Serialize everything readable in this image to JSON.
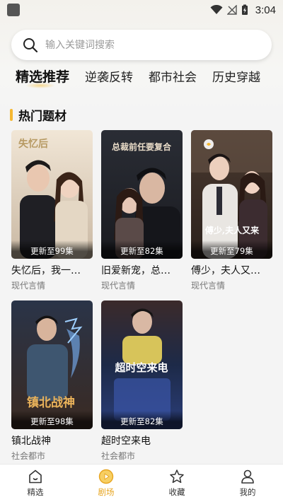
{
  "status_bar": {
    "time": "3:04"
  },
  "search": {
    "placeholder": "输入关键词搜索"
  },
  "tabs": [
    {
      "label": "精选推荐",
      "active": true
    },
    {
      "label": "逆袭反转",
      "active": false
    },
    {
      "label": "都市社会",
      "active": false
    },
    {
      "label": "历史穿越",
      "active": false
    }
  ],
  "section": {
    "title": "热门题材"
  },
  "dramas": [
    {
      "title": "失忆后，我一…",
      "genre": "现代言情",
      "episodes": "更新至99集",
      "poster_text": "失忆后"
    },
    {
      "title": "旧爱新宠，总…",
      "genre": "现代言情",
      "episodes": "更新至82集",
      "poster_text": "总裁前任要复合"
    },
    {
      "title": "傅少，夫人又…",
      "genre": "现代言情",
      "episodes": "更新至79集",
      "poster_text": "傅少,夫人又来"
    },
    {
      "title": "镇北战神",
      "genre": "社会都市",
      "episodes": "更新至98集",
      "poster_text": "镇北战神"
    },
    {
      "title": "超时空来电",
      "genre": "社会都市",
      "episodes": "更新至82集",
      "poster_text": "超时空来电"
    }
  ],
  "bottom_nav": [
    {
      "label": "精选",
      "icon": "home-icon",
      "active": false
    },
    {
      "label": "剧场",
      "icon": "play-circle-icon",
      "active": true
    },
    {
      "label": "收藏",
      "icon": "star-icon",
      "active": false
    },
    {
      "label": "我的",
      "icon": "user-icon",
      "active": false
    }
  ],
  "colors": {
    "accent": "#f5b731",
    "active_nav": "#e7a41e"
  }
}
